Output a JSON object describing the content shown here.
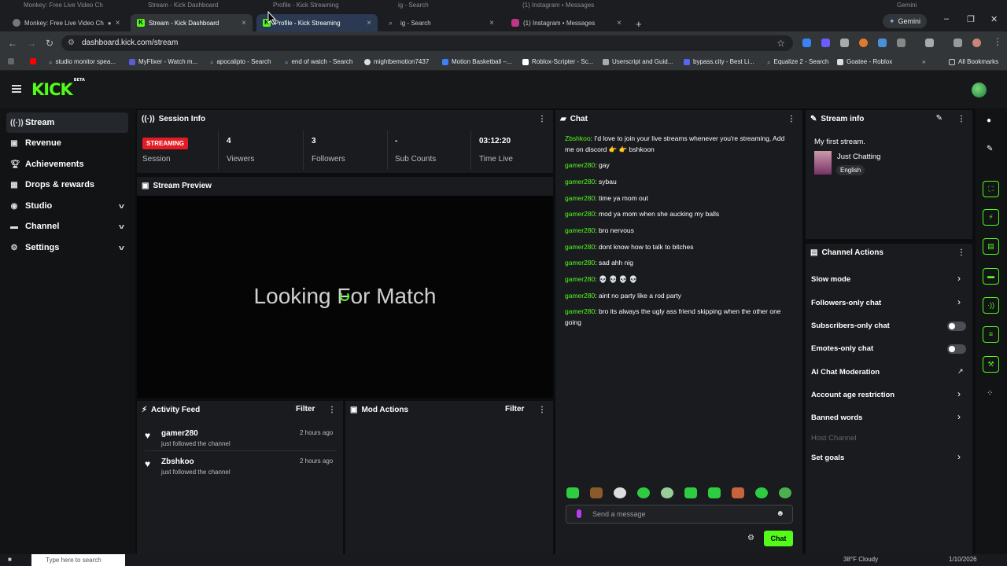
{
  "ghost_tabs": [
    "Monkey: Free Live Video Ch",
    "Stream - Kick Dashboard",
    "Profile - Kick Streaming",
    "ig - Search",
    "(1) Instagram • Messages",
    "Gemini"
  ],
  "tabs": [
    {
      "label": "Monkey: Free Live Video Ch"
    },
    {
      "label": "Stream - Kick Dashboard"
    },
    {
      "label": "Profile - Kick Streaming"
    },
    {
      "label": "ig - Search"
    },
    {
      "label": "(1) Instagram • Messages"
    }
  ],
  "gemini_label": "Gemini",
  "url": "dashboard.kick.com/stream",
  "bookmarks": [
    "studio monitor spea...",
    "MyFlixer - Watch m...",
    "apocalipto - Search",
    "end of watch - Search",
    "mightbemotion7437",
    "Motion Basketball –...",
    "Roblox-Scripter - Sc...",
    "Userscript and Guid...",
    "bypass.city - Best Li...",
    "Equalize 2 - Search",
    "Goatee - Roblox"
  ],
  "all_bookmarks": "All Bookmarks",
  "logo": {
    "text": "KICK",
    "sup": "BETA"
  },
  "sidebar": [
    {
      "label": "Stream",
      "icon": "broadcast-icon"
    },
    {
      "label": "Revenue",
      "icon": "revenue-icon"
    },
    {
      "label": "Achievements",
      "icon": "trophy-icon"
    },
    {
      "label": "Drops & rewards",
      "icon": "gift-icon"
    },
    {
      "label": "Studio",
      "icon": "studio-icon"
    },
    {
      "label": "Channel",
      "icon": "channel-icon"
    },
    {
      "label": "Settings",
      "icon": "gear-icon"
    }
  ],
  "session": {
    "title": "Session Info",
    "badge": "STREAMING",
    "session_label": "Session",
    "stats": [
      {
        "value": "4",
        "label": "Viewers"
      },
      {
        "value": "3",
        "label": "Followers"
      },
      {
        "value": "-",
        "label": "Sub Counts"
      },
      {
        "value": "03:12:20",
        "label": "Time Live"
      }
    ]
  },
  "preview": {
    "title": "Stream Preview",
    "overlay": "Looking For Match"
  },
  "activity": {
    "title": "Activity Feed",
    "filter": "Filter",
    "items": [
      {
        "name": "gamer280",
        "action": "just followed the channel",
        "time": "2 hours ago"
      },
      {
        "name": "Zbshkoo",
        "action": "just followed the channel",
        "time": "2 hours ago"
      }
    ]
  },
  "mod": {
    "title": "Mod Actions",
    "filter": "Filter"
  },
  "chat": {
    "title": "Chat",
    "messages": [
      {
        "user": "Zbshkoo",
        "text": "I'd love to join your live streams whenever you're streaming, Add me on discord 👉 👉 bshkoon"
      },
      {
        "user": "gamer280",
        "text": "gay"
      },
      {
        "user": "gamer280",
        "text": "sybau"
      },
      {
        "user": "gamer280",
        "text": "time ya mom out"
      },
      {
        "user": "gamer280",
        "text": "mod ya mom when she aucking my balls"
      },
      {
        "user": "gamer280",
        "text": "bro nervous"
      },
      {
        "user": "gamer280",
        "text": "dont know how to talk to bitches"
      },
      {
        "user": "gamer280",
        "text": "sad ahh nig"
      },
      {
        "user": "gamer280",
        "text": "💀 💀 💀 💀"
      },
      {
        "user": "gamer280",
        "text": "aint no party like a rod party"
      },
      {
        "user": "gamer280",
        "text": "bro its always the ugly ass friend skipping when the other one going"
      }
    ],
    "placeholder": "Send a message",
    "send_label": "Chat"
  },
  "stream_info": {
    "title": "Stream info",
    "stream_title": "My first stream.",
    "category": "Just Chatting",
    "language": "English"
  },
  "channel_actions": {
    "title": "Channel Actions",
    "items": [
      {
        "label": "Slow mode",
        "control": "arrow"
      },
      {
        "label": "Followers-only chat",
        "control": "arrow"
      },
      {
        "label": "Subscribers-only chat",
        "control": "toggle"
      },
      {
        "label": "Emotes-only chat",
        "control": "toggle"
      },
      {
        "label": "AI Chat Moderation",
        "control": "external"
      },
      {
        "label": "Account age restriction",
        "control": "arrow"
      },
      {
        "label": "Banned words",
        "control": "arrow"
      },
      {
        "label": "Host Channel",
        "control": "none",
        "disabled": true
      },
      {
        "label": "Set goals",
        "control": "arrow"
      }
    ]
  },
  "taskbar": {
    "search": "Type here to search",
    "weather": "38°F Cloudy",
    "date": "1/10/2026"
  }
}
